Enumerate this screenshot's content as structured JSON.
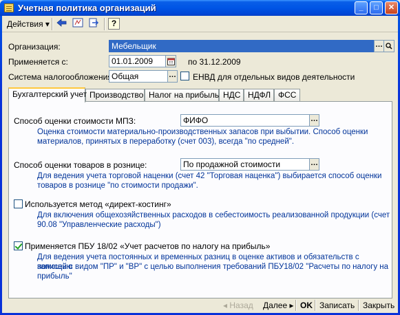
{
  "window": {
    "title": "Учетная политика организаций"
  },
  "toolbar": {
    "actions_label": "Действия",
    "actions_arrow": "▾",
    "help_label": "?"
  },
  "form": {
    "org_label": "Организация:",
    "org_value": "Мебельщик",
    "date_label": "Применяется с:",
    "date_value": "01.01.2009",
    "date_to": "по 31.12.2009",
    "tax_label": "Система налогообложения:",
    "tax_value": "Общая",
    "envd_label": "ЕНВД для отдельных видов деятельности",
    "envd_checked": false
  },
  "tabs": [
    "Бухгалтерский учет",
    "Производство",
    "Налог на прибыль",
    "НДС",
    "НДФЛ",
    "ФСС"
  ],
  "panel": {
    "mpz_label": "Способ оценки стоимости МПЗ:",
    "mpz_value": "ФИФО",
    "mpz_desc_1": "Оценка стоимости материально-производственных запасов при выбытии. Способ оценки",
    "mpz_desc_2": "материалов, принятых в переработку (счет 003), всегда \"по средней\".",
    "retail_label": "Способ оценки товаров в рознице:",
    "retail_value": "По продажной стоимости",
    "retail_desc_1": "Для ведения учета торговой наценки (счет 42 \"Торговая наценка\") выбирается способ оценки",
    "retail_desc_2": "товаров в рознице \"по стоимости продажи\".",
    "direct_label": "Используется метод «директ-костинг»",
    "direct_checked": false,
    "direct_desc_1": "Для включения общехозяйственных расходов в себестоимость реализованной продукции (счет",
    "direct_desc_2": "90.08 \"Управленческие расходы\")",
    "pbu_label": "Применяется ПБУ 18/02 «Учет расчетов по налогу на прибыль»",
    "pbu_checked": true,
    "pbu_desc_1": "Для ведения учета постоянных и временных разниц в оценке активов и обязательств с помощью",
    "pbu_desc_2": "записей с видом \"ПР\" и \"ВР\" с целью выполнения требований ПБУ18/02 \"Расчеты по налогу на",
    "pbu_desc_3": "прибыль\""
  },
  "buttons": {
    "back": "◂ Назад",
    "next": "Далее ▸",
    "ok": "OK",
    "save": "Записать",
    "close": "Закрыть"
  },
  "colors": {
    "title_blue": "#0055e5",
    "desc_blue": "#003399",
    "selection": "#316ac5",
    "tab_highlight": "#ffc83c"
  }
}
